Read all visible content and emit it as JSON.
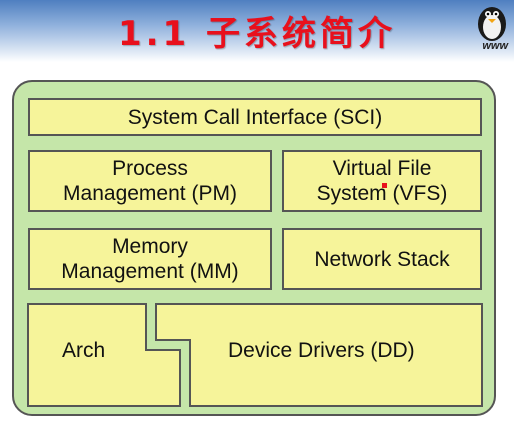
{
  "header": {
    "title": "1.1 子系统简介",
    "logo": {
      "icon": "penguin-icon",
      "text": "www"
    }
  },
  "diagram": {
    "sci": "System Call Interface (SCI)",
    "pm": "Process\nManagement (PM)",
    "vfs": "Virtual File\nSystem (VFS)",
    "mm": "Memory\nManagement (MM)",
    "net": "Network Stack",
    "arch": "Arch",
    "dd": "Device Drivers (DD)"
  },
  "colors": {
    "outer_fill": "#c5e6a9",
    "box_fill": "#f6f49a",
    "title_color": "#e8101c",
    "border": "#555555"
  }
}
